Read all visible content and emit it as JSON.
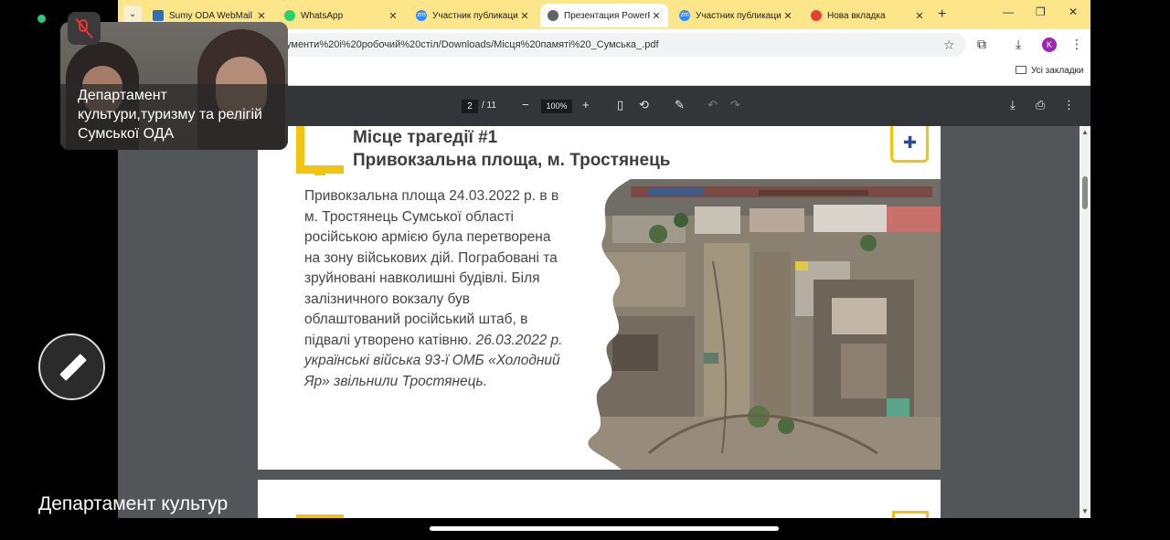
{
  "meeting": {
    "caption": "Департамент культури,туризму та релігій  Сумської ОДА",
    "bottom_caption": "Департамент культур"
  },
  "browser": {
    "tabs": [
      {
        "label": "Sumy ODA WebMail",
        "favicon_color": "#2f6fb5"
      },
      {
        "label": "WhatsApp",
        "favicon_color": "#25d366"
      },
      {
        "label": "Участник публикаци",
        "favicon_color": "#2d8cff"
      },
      {
        "label": "Презентация PowerP",
        "favicon_color": "#5f6368",
        "active": true
      },
      {
        "label": "Участник публикаци",
        "favicon_color": "#2d8cff"
      },
      {
        "label": "Нова вкладка",
        "favicon_color": "#e34133"
      }
    ],
    "url": "ументи%20і%20робочий%20стіл/Downloads/Місця%20памяті%20_Сумська_.pdf",
    "profile_initial": "K",
    "bookmarks_all": "Усі закладки"
  },
  "pdf": {
    "current_page": "2",
    "total_pages": "/ 11",
    "zoom": "100%"
  },
  "slide": {
    "title1": "Місце трагедії #1",
    "title2": "Привокзальна площа, м. Тростянець",
    "body": "Привокзальна площа 24.03.2022 р. в в м. Тростянець Сумської області російською армією була перетворена  на зону військових дій. Пограбовані та зруйновані навколишні будівлі. Біля залізничного вокзалу був облаштований російський штаб, в підвалі утворено катівню.",
    "body_italic": "26.03.2022 р. українські війська 93-ї ОМБ «Холодний Яр» звільнили Тростянець."
  },
  "colors": {
    "accent_yellow": "#f2c40f",
    "tabbar": "#fde68a",
    "pdf_toolbar": "#323639",
    "pdf_bg": "#525659"
  }
}
